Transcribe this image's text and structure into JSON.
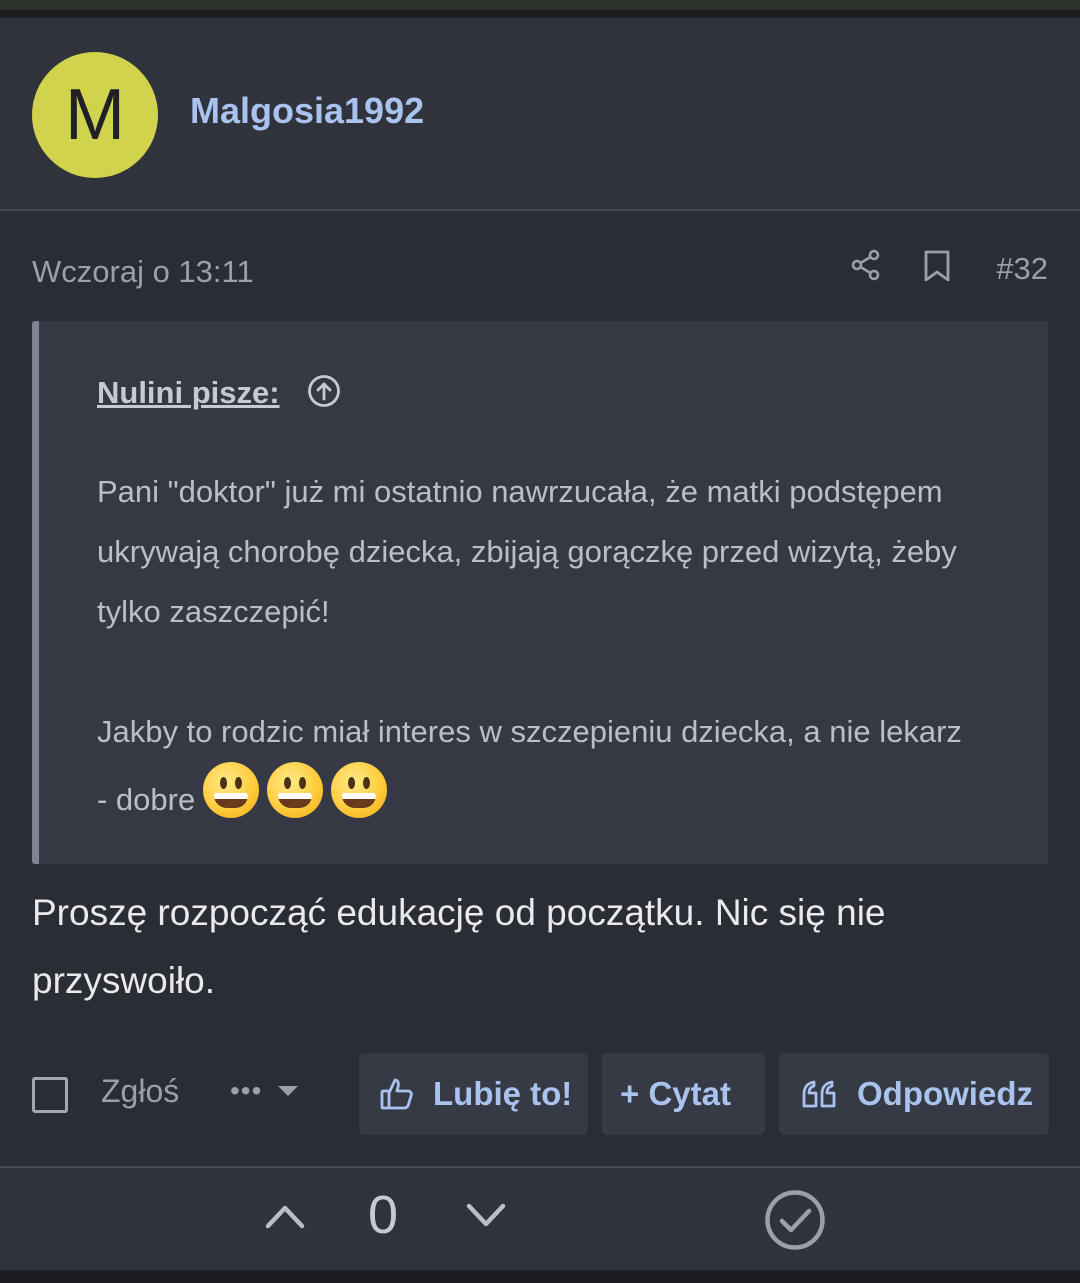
{
  "post": {
    "avatar_letter": "M",
    "username": "Malgosia1992",
    "date": "Wczoraj o 13:11",
    "post_number": "#32"
  },
  "quote": {
    "title": "Nulini pisze:",
    "paragraph1": "Pani \"doktor\" już mi ostatnio nawrzucała, że matki podstępem ukrywają chorobę dziecka, zbijają gorączkę przed wizytą, żeby tylko zaszczepić!",
    "paragraph2": "Jakby to rodzic miał interes w szczepieniu dziecka, a nie lekarz - dobre",
    "emoji_count": 3,
    "emoji_icon": "grinning-face"
  },
  "reply": {
    "text": "Proszę rozpocząć edukację od początku. Nic się nie przyswoiło."
  },
  "actions": {
    "report_label": "Zgłoś",
    "more_label": "•••",
    "like_label": "Lubię to!",
    "quote_label": "+ Cytat",
    "reply_label": "Odpowiedz"
  },
  "votes": {
    "count": "0"
  },
  "colors": {
    "accent": "#a9c2ee",
    "avatar_bg": "#d1d34d",
    "background": "#2b2d34"
  }
}
